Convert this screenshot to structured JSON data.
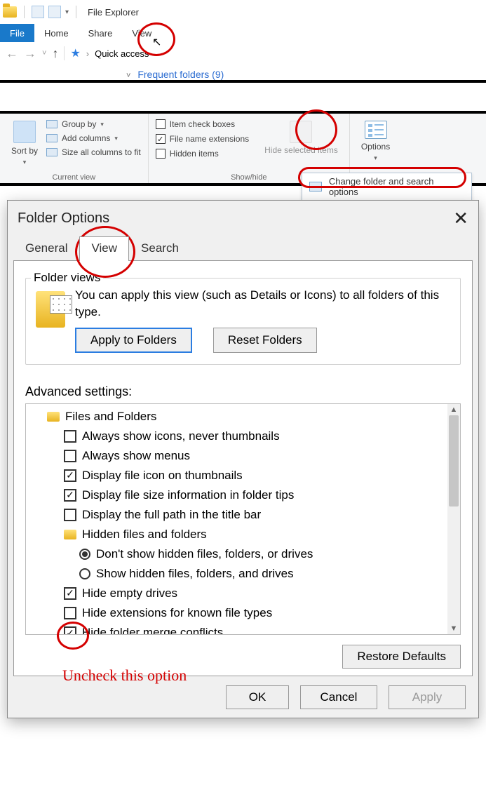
{
  "explorer": {
    "title": "File Explorer",
    "tabs": {
      "file": "File",
      "home": "Home",
      "share": "Share",
      "view": "View"
    },
    "breadcrumb": "Quick access",
    "content": {
      "frequent": "Frequent folders (9)"
    }
  },
  "ribbon": {
    "sort_by": "Sort by",
    "group_by": "Group by",
    "add_columns": "Add columns",
    "size_all": "Size all columns to fit",
    "current_view_label": "Current view",
    "item_check_boxes": "Item check boxes",
    "file_name_ext": "File name extensions",
    "hidden_items": "Hidden items",
    "show_hide_label": "Show/hide",
    "hide_selected": "Hide selected items",
    "options": "Options",
    "change_folder": "Change folder and search options"
  },
  "dialog": {
    "title": "Folder Options",
    "tabs": {
      "general": "General",
      "view": "View",
      "search": "Search"
    },
    "folder_views_label": "Folder views",
    "folder_views_text": "You can apply this view (such as Details or Icons) to all folders of this type.",
    "apply_to_folders": "Apply to Folders",
    "reset_folders": "Reset Folders",
    "advanced_label": "Advanced settings:",
    "tree": {
      "root": "Files and Folders",
      "items": [
        {
          "type": "check",
          "checked": false,
          "label": "Always show icons, never thumbnails"
        },
        {
          "type": "check",
          "checked": false,
          "label": "Always show menus"
        },
        {
          "type": "check",
          "checked": true,
          "label": "Display file icon on thumbnails"
        },
        {
          "type": "check",
          "checked": true,
          "label": "Display file size information in folder tips"
        },
        {
          "type": "check",
          "checked": false,
          "label": "Display the full path in the title bar"
        },
        {
          "type": "folder",
          "label": "Hidden files and folders"
        },
        {
          "type": "radio",
          "checked": true,
          "label": "Don't show hidden files, folders, or drives"
        },
        {
          "type": "radio",
          "checked": false,
          "label": "Show hidden files, folders, and drives"
        },
        {
          "type": "check",
          "checked": true,
          "label": "Hide empty drives"
        },
        {
          "type": "check",
          "checked": false,
          "label": "Hide extensions for known file types"
        },
        {
          "type": "check",
          "checked": true,
          "label": "Hide folder merge conflicts"
        }
      ]
    },
    "restore_defaults": "Restore Defaults",
    "ok": "OK",
    "cancel": "Cancel",
    "apply": "Apply"
  },
  "annotation": {
    "uncheck": "Uncheck this option"
  }
}
